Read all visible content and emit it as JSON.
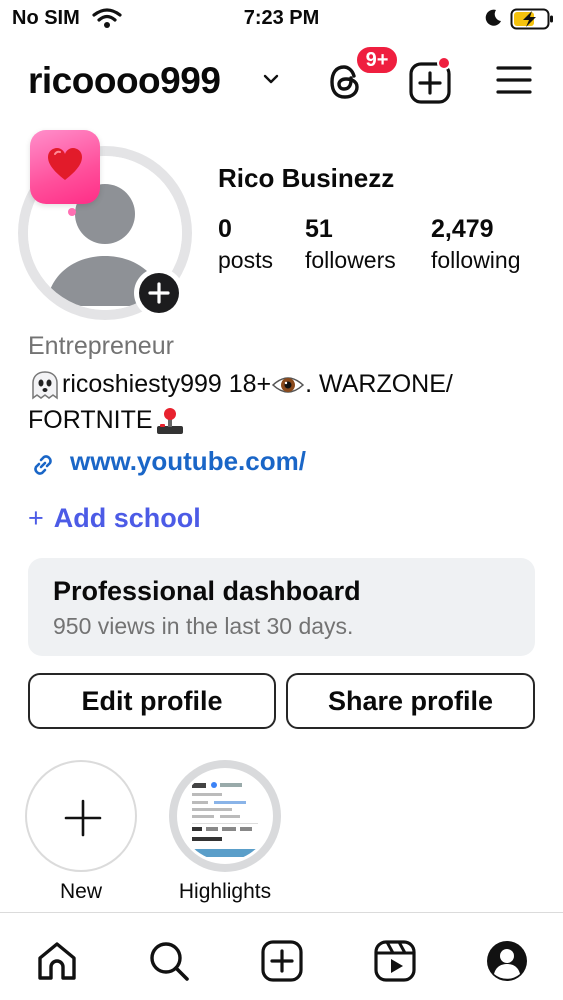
{
  "status_bar": {
    "carrier": "No SIM",
    "time": "7:23 PM"
  },
  "header": {
    "username": "ricoooo999",
    "notification_badge": "9+"
  },
  "profile": {
    "full_name": "Rico Businezz",
    "stats": [
      {
        "value": "0",
        "label": "posts"
      },
      {
        "value": "51",
        "label": "followers"
      },
      {
        "value": "2,479",
        "label": "following"
      }
    ],
    "category": "Entrepreneur",
    "bio_line1_text": "ricoshiesty999 18+",
    "bio_line1_tail": ". WARZONE/",
    "bio_line2_text": "FORTNITE",
    "link": "www.youtube.com/",
    "add_school_icon": "+",
    "add_school": "Add school"
  },
  "dashboard": {
    "title": "Professional dashboard",
    "subtitle": "950 views in the last 30 days."
  },
  "buttons": {
    "edit": "Edit profile",
    "share": "Share profile"
  },
  "highlights": [
    {
      "label": "New"
    },
    {
      "label": "Highlights"
    }
  ],
  "colors": {
    "link_blue": "#1a66c7",
    "school_blue": "#4c5be6",
    "badge_red": "#ef1f3f",
    "note_pink": "#ff4f9b"
  },
  "icons": [
    "wifi-icon",
    "moon-icon",
    "battery-charging-icon",
    "chevron-down-icon",
    "threads-icon",
    "new-post-icon",
    "menu-icon",
    "heart-emoji-icon",
    "ghost-emoji-icon",
    "eye-emoji-icon",
    "joystick-emoji-icon",
    "link-icon",
    "home-icon",
    "search-icon",
    "create-icon",
    "reels-icon",
    "profile-icon"
  ]
}
